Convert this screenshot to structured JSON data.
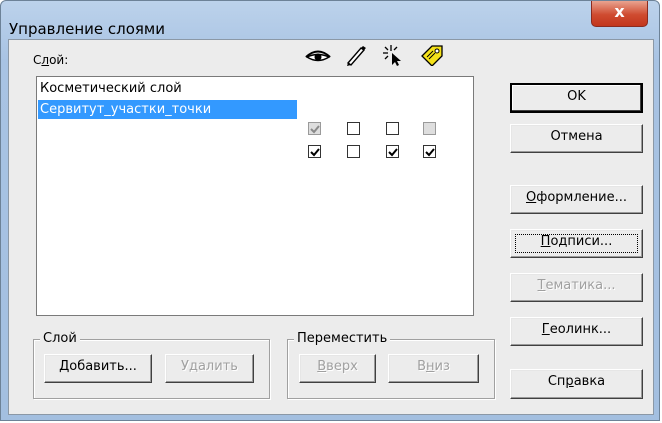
{
  "window": {
    "title": "Управление слоями",
    "close_glyph": "x"
  },
  "layer_label": {
    "prefix": "С",
    "underlined": "л",
    "suffix": "ой:"
  },
  "header_icons": [
    "eye-icon",
    "pencil-icon",
    "cursor-sparkle-icon",
    "tag-icon"
  ],
  "layers": [
    {
      "name": "Косметический слой",
      "visible": true,
      "editable": false,
      "selectable": false,
      "labels": false,
      "visible_disabled": true,
      "labels_disabled": true,
      "selected": false
    },
    {
      "name": "Сервитут_участки_точки",
      "visible": true,
      "editable": false,
      "selectable": true,
      "labels": true,
      "visible_disabled": false,
      "labels_disabled": false,
      "selected": true
    }
  ],
  "groups": {
    "layer": {
      "title": "Слой",
      "add": {
        "u": "Д",
        "rest": "обавить..."
      },
      "remove": {
        "pre": "У",
        "u": "д",
        "rest": "алить"
      }
    },
    "move": {
      "title": "Переместить",
      "up": {
        "u": "В",
        "rest": "верх"
      },
      "down": {
        "pre": "В",
        "u": "н",
        "rest": "из"
      }
    }
  },
  "buttons": {
    "ok": "OK",
    "cancel": "Отмена",
    "design": {
      "u": "О",
      "rest": "формление..."
    },
    "labels": {
      "u": "П",
      "rest": "одписи..."
    },
    "thematic": {
      "u": "Т",
      "rest": "ематика..."
    },
    "geolink": {
      "u": "Г",
      "rest": "еолинк..."
    },
    "help": {
      "pre": "Сп",
      "u": "р",
      "rest": "авка"
    }
  }
}
